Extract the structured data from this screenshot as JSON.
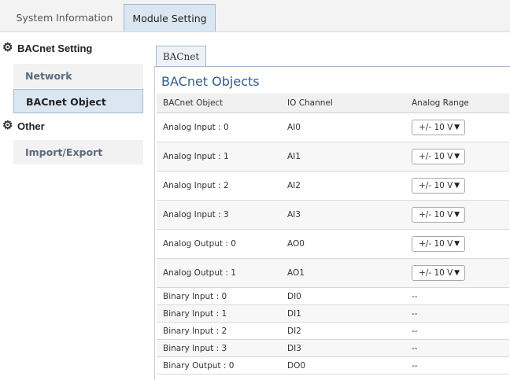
{
  "top_tabs": [
    {
      "label": "System Information",
      "active": false
    },
    {
      "label": "Module Setting",
      "active": true
    }
  ],
  "sidebar": {
    "groups": [
      {
        "label": "BACnet Setting",
        "icon": "gear-icon",
        "items": [
          {
            "label": "Network",
            "selected": false
          },
          {
            "label": "BACnet Object",
            "selected": true
          }
        ]
      },
      {
        "label": "Other",
        "icon": "gear-icon",
        "items": [
          {
            "label": "Import/Export",
            "selected": false
          }
        ]
      }
    ]
  },
  "main": {
    "tab_label": "BACnet",
    "section_title": "BACnet Objects",
    "columns": [
      "BACnet Object",
      "IO Channel",
      "Analog Range"
    ],
    "rows": [
      {
        "object": "Analog Input : 0",
        "channel": "AI0",
        "range": "+/- 10 V"
      },
      {
        "object": "Analog Input : 1",
        "channel": "AI1",
        "range": "+/- 10 V"
      },
      {
        "object": "Analog Input : 2",
        "channel": "AI2",
        "range": "+/- 10 V"
      },
      {
        "object": "Analog Input : 3",
        "channel": "AI3",
        "range": "+/- 10 V"
      },
      {
        "object": "Analog Output : 0",
        "channel": "AO0",
        "range": "+/- 10 V"
      },
      {
        "object": "Analog Output : 1",
        "channel": "AO1",
        "range": "+/- 10 V"
      },
      {
        "object": "Binary Input : 0",
        "channel": "DI0",
        "range": "--"
      },
      {
        "object": "Binary Input : 1",
        "channel": "DI1",
        "range": "--"
      },
      {
        "object": "Binary Input : 2",
        "channel": "DI2",
        "range": "--"
      },
      {
        "object": "Binary Input : 3",
        "channel": "DI3",
        "range": "--"
      },
      {
        "object": "Binary Output : 0",
        "channel": "DO0",
        "range": "--"
      }
    ]
  },
  "colors": {
    "accent_tab": "#dbe6f3",
    "tab_border": "#9fb8d6",
    "title_blue": "#2f5d8a"
  }
}
